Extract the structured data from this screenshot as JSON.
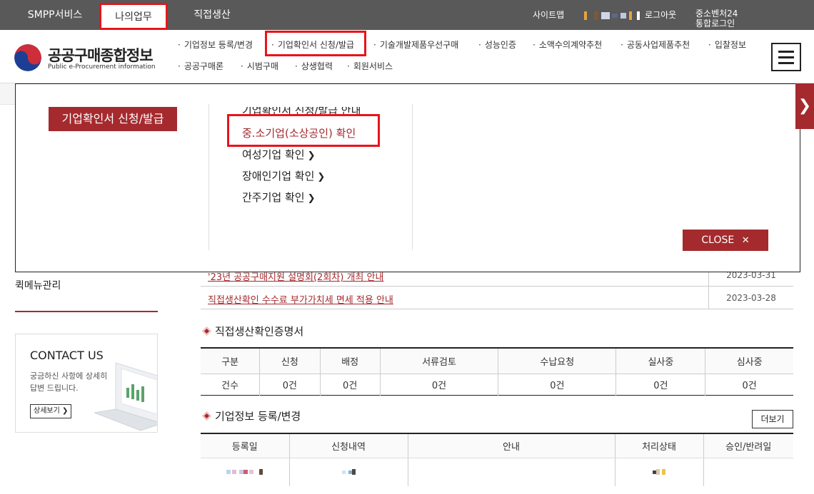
{
  "topbar": {
    "tabs": [
      "SMPP서비스",
      "나의업무",
      "직접생산"
    ],
    "utils": {
      "sitemap": "사이트맵",
      "logout": "로그아웃",
      "sme_login_1": "중소벤처24",
      "sme_login_2": "통합로그인"
    }
  },
  "logo": {
    "main": "공공구매종합정보",
    "sub": "Public e-Procurement information"
  },
  "gnb": [
    "기업정보 등록/변경",
    "기업확인서 신청/발급",
    "기술개발제품우선구매",
    "성능인증",
    "소액수의계약추천",
    "공동사업제품추천",
    "입찰정보",
    "공공구매론",
    "시범구매",
    "상생협력",
    "회원서비스"
  ],
  "panel": {
    "title": "기업확인서 신청/발급",
    "links": [
      "기업확인서 신청/발급 안내",
      "중.소기업(소상공인) 확인",
      "여성기업 확인",
      "장애인기업 확인",
      "간주기업 확인"
    ],
    "close": "CLOSE"
  },
  "left": {
    "quick_menu": "퀵메뉴관리",
    "contact_title": "CONTACT US",
    "contact_text": "궁금하신 사항에 상세히 답변 드립니다.",
    "contact_btn": "상세보기"
  },
  "notices": [
    {
      "title": "'23년 공공구매지원 설명회(2회차) 개최 안내",
      "date": "2023-03-31"
    },
    {
      "title": "직접생산확인 수수료 부가가치세 면세 적용 안내",
      "date": "2023-03-28"
    }
  ],
  "direct_production": {
    "title": "직접생산확인증명서",
    "headers": [
      "구분",
      "신청",
      "배정",
      "서류검토",
      "수납요청",
      "실사중",
      "심사중"
    ],
    "row": [
      "건수",
      "0건",
      "0건",
      "0건",
      "0건",
      "0건",
      "0건"
    ]
  },
  "company_info": {
    "title": "기업정보 등록/변경",
    "more": "더보기",
    "headers": [
      "등록일",
      "신청내역",
      "안내",
      "처리상태",
      "승인/반려일"
    ]
  },
  "colors": {
    "accent": "#a52a2e",
    "topbar": "#595959",
    "highlight": "#e8141b"
  }
}
